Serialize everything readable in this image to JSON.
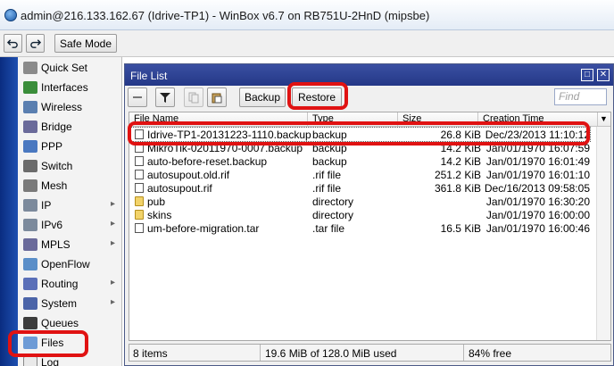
{
  "window": {
    "title": "admin@216.133.162.67 (Idrive-TP1) - WinBox v6.7 on RB751U-2HnD (mipsbe)"
  },
  "toolbar": {
    "safe_mode_label": "Safe Mode"
  },
  "sidebar": {
    "items": [
      {
        "label": "Quick Set",
        "icon": "quick-set-icon",
        "submenu": false
      },
      {
        "label": "Interfaces",
        "icon": "interfaces-icon",
        "submenu": false
      },
      {
        "label": "Wireless",
        "icon": "wireless-icon",
        "submenu": false
      },
      {
        "label": "Bridge",
        "icon": "bridge-icon",
        "submenu": false
      },
      {
        "label": "PPP",
        "icon": "ppp-icon",
        "submenu": false
      },
      {
        "label": "Switch",
        "icon": "switch-icon",
        "submenu": false
      },
      {
        "label": "Mesh",
        "icon": "mesh-icon",
        "submenu": false
      },
      {
        "label": "IP",
        "icon": "ip-icon",
        "submenu": true
      },
      {
        "label": "IPv6",
        "icon": "ipv6-icon",
        "submenu": true
      },
      {
        "label": "MPLS",
        "icon": "mpls-icon",
        "submenu": true
      },
      {
        "label": "OpenFlow",
        "icon": "openflow-icon",
        "submenu": false
      },
      {
        "label": "Routing",
        "icon": "routing-icon",
        "submenu": true
      },
      {
        "label": "System",
        "icon": "system-icon",
        "submenu": true
      },
      {
        "label": "Queues",
        "icon": "queues-icon",
        "submenu": false
      },
      {
        "label": "Files",
        "icon": "files-icon",
        "submenu": false
      },
      {
        "label": "Log",
        "icon": "log-icon",
        "submenu": false
      }
    ]
  },
  "file_list": {
    "title": "File List",
    "buttons": {
      "backup": "Backup",
      "restore": "Restore"
    },
    "find_placeholder": "Find",
    "columns": {
      "name": "File Name",
      "type": "Type",
      "size": "Size",
      "date": "Creation Time"
    },
    "rows": [
      {
        "name": "Idrive-TP1-20131223-1110.backup",
        "type": "backup",
        "size": "26.8 KiB",
        "date": "Dec/23/2013 11:10:12",
        "kind": "file"
      },
      {
        "name": "MikroTik-02011970-0007.backup",
        "type": "backup",
        "size": "14.2 KiB",
        "date": "Jan/01/1970 16:07:59",
        "kind": "file"
      },
      {
        "name": "auto-before-reset.backup",
        "type": "backup",
        "size": "14.2 KiB",
        "date": "Jan/01/1970 16:01:49",
        "kind": "file"
      },
      {
        "name": "autosupout.old.rif",
        "type": ".rif file",
        "size": "251.2 KiB",
        "date": "Jan/01/1970 16:01:10",
        "kind": "file"
      },
      {
        "name": "autosupout.rif",
        "type": ".rif file",
        "size": "361.8 KiB",
        "date": "Dec/16/2013 09:58:05",
        "kind": "file"
      },
      {
        "name": "pub",
        "type": "directory",
        "size": "",
        "date": "Jan/01/1970 16:30:20",
        "kind": "folder"
      },
      {
        "name": "skins",
        "type": "directory",
        "size": "",
        "date": "Jan/01/1970 16:00:00",
        "kind": "folder"
      },
      {
        "name": "um-before-migration.tar",
        "type": ".tar file",
        "size": "16.5 KiB",
        "date": "Jan/01/1970 16:00:46",
        "kind": "file"
      }
    ],
    "status": {
      "items": "8 items",
      "usage": "19.6 MiB of 128.0 MiB used",
      "free": "84% free"
    }
  },
  "colors": {
    "annotation": "#e01212",
    "window_title": "#2c3f94",
    "sidebar_strip": "#1d4fb0"
  }
}
